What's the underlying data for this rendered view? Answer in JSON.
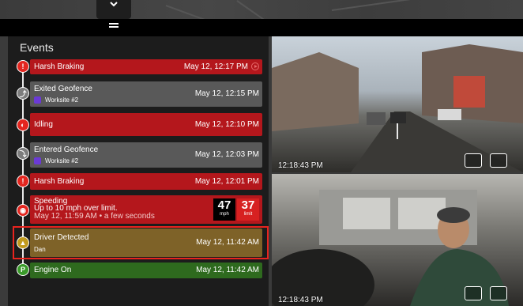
{
  "header": {
    "collapse_icon": "chevron-down-icon",
    "menu_icon": "menu-icon"
  },
  "events_panel": {
    "title": "Events",
    "events": [
      {
        "type": "Harsh Braking",
        "time": "May 12, 12:17 PM",
        "color": "#b4171c",
        "icon": "warning-icon"
      },
      {
        "type": "Exited Geofence",
        "location": "Worksite #2",
        "time": "May 12, 12:15 PM",
        "color": "#595959",
        "icon": "geofence-exit-icon"
      },
      {
        "type": "Idling",
        "time": "May 12, 12:10 PM",
        "color": "#b4171c",
        "icon": "idle-icon"
      },
      {
        "type": "Entered Geofence",
        "location": "Worksite #2",
        "time": "May 12, 12:03 PM",
        "color": "#595959",
        "icon": "geofence-enter-icon"
      },
      {
        "type": "Harsh Braking",
        "time": "May 12, 12:01 PM",
        "color": "#b4171c",
        "icon": "warning-icon"
      },
      {
        "type": "Speeding",
        "detail": "Up to 10 mph over limit.",
        "time": "May 12, 11:59 AM • a few seconds",
        "color": "#b4171c",
        "icon": "speeding-icon",
        "speed": "47",
        "speed_unit": "mph",
        "limit": "37",
        "limit_label": "limit"
      },
      {
        "type": "Driver Detected",
        "driver": "Dan",
        "time": "May 12, 11:42 AM",
        "color": "#7e6228",
        "icon": "driver-icon"
      },
      {
        "type": "Engine On",
        "time": "May 12, 11:42 AM",
        "color": "#2e6a1e",
        "icon": "engine-on-icon"
      }
    ]
  },
  "videos": [
    {
      "name": "road-facing",
      "timestamp": "12:18:43 PM"
    },
    {
      "name": "driver-facing",
      "timestamp": "12:18:43 PM"
    }
  ]
}
